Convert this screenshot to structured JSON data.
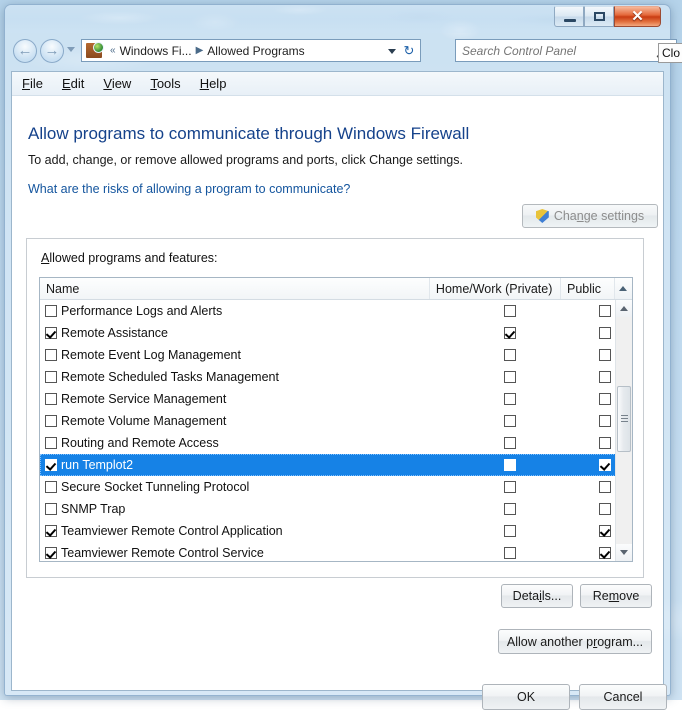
{
  "window": {
    "controls": {
      "minimize": "minimize",
      "maximize": "maximize",
      "close_glyph": "✕"
    }
  },
  "navigation": {
    "back_glyph": "←",
    "forward_glyph": "→",
    "breadcrumb": {
      "overflow": "«",
      "parent": "Windows Fi...",
      "separator": "▶",
      "current": "Allowed Programs"
    },
    "refresh_glyph": "↻"
  },
  "search": {
    "placeholder": "Search Control Panel",
    "value": "",
    "icon": "search-icon"
  },
  "tooltip": {
    "text": "Clo"
  },
  "menubar": {
    "items": [
      {
        "accel": "F",
        "rest": "ile"
      },
      {
        "accel": "E",
        "rest": "dit"
      },
      {
        "accel": "V",
        "rest": "iew"
      },
      {
        "accel": "T",
        "rest": "ools"
      },
      {
        "accel": "H",
        "rest": "elp"
      }
    ]
  },
  "page": {
    "heading": "Allow programs to communicate through Windows Firewall",
    "subtext": "To add, change, or remove allowed programs and ports, click Change settings.",
    "risk_link": "What are the risks of allowing a program to communicate?",
    "change_settings": {
      "prefix": "Cha",
      "accel": "n",
      "suffix": "ge settings",
      "enabled": false,
      "icon": "shield-icon"
    }
  },
  "groupbox": {
    "label": {
      "accel": "A",
      "rest": "llowed programs and features:"
    }
  },
  "list": {
    "columns": [
      "Name",
      "Home/Work (Private)",
      "Public"
    ],
    "rows": [
      {
        "name": "Performance Logs and Alerts",
        "enabled": false,
        "private": false,
        "public": false,
        "selected": false
      },
      {
        "name": "Remote Assistance",
        "enabled": true,
        "private": true,
        "public": false,
        "selected": false
      },
      {
        "name": "Remote Event Log Management",
        "enabled": false,
        "private": false,
        "public": false,
        "selected": false
      },
      {
        "name": "Remote Scheduled Tasks Management",
        "enabled": false,
        "private": false,
        "public": false,
        "selected": false
      },
      {
        "name": "Remote Service Management",
        "enabled": false,
        "private": false,
        "public": false,
        "selected": false
      },
      {
        "name": "Remote Volume Management",
        "enabled": false,
        "private": false,
        "public": false,
        "selected": false
      },
      {
        "name": "Routing and Remote Access",
        "enabled": false,
        "private": false,
        "public": false,
        "selected": false
      },
      {
        "name": "run Templot2",
        "enabled": true,
        "private": false,
        "public": true,
        "selected": true
      },
      {
        "name": "Secure Socket Tunneling Protocol",
        "enabled": false,
        "private": false,
        "public": false,
        "selected": false
      },
      {
        "name": "SNMP Trap",
        "enabled": false,
        "private": false,
        "public": false,
        "selected": false
      },
      {
        "name": "Teamviewer Remote Control Application",
        "enabled": true,
        "private": false,
        "public": true,
        "selected": false
      },
      {
        "name": "Teamviewer Remote Control Service",
        "enabled": true,
        "private": false,
        "public": true,
        "selected": false
      }
    ],
    "scrollbar": {
      "up_arrow": "up",
      "down_arrow": "down"
    }
  },
  "buttons": {
    "details": {
      "prefix": "Deta",
      "accel": "i",
      "suffix": "ls..."
    },
    "remove": {
      "prefix": "Re",
      "accel": "m",
      "suffix": "ove"
    },
    "allow_another": {
      "prefix": "Allow another p",
      "accel": "r",
      "suffix": "ogram..."
    },
    "ok": "OK",
    "cancel": "Cancel"
  }
}
